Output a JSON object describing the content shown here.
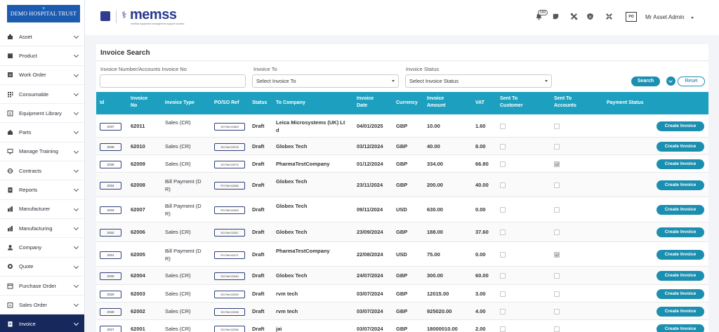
{
  "org": {
    "name": "DEMO HOSPITAL TRUST"
  },
  "brand": {
    "name": "memss",
    "tagline": "medical equipment management support solution"
  },
  "header": {
    "notification_count": "690",
    "user_name": "Mr Asset Admin",
    "avatar_text": "PO"
  },
  "sidebar": {
    "items": [
      {
        "label": "Asset",
        "icon": "asset-icon"
      },
      {
        "label": "Product",
        "icon": "product-icon"
      },
      {
        "label": "Work Order",
        "icon": "work-order-icon"
      },
      {
        "label": "Consumable",
        "icon": "consumable-icon"
      },
      {
        "label": "Equipment Library",
        "icon": "library-icon"
      },
      {
        "label": "Parts",
        "icon": "parts-icon"
      },
      {
        "label": "Manage Training",
        "icon": "training-icon"
      },
      {
        "label": "Contracts",
        "icon": "contracts-icon"
      },
      {
        "label": "Reports",
        "icon": "reports-icon"
      },
      {
        "label": "Manufacturer",
        "icon": "manufacturer-icon"
      },
      {
        "label": "Manufacturing",
        "icon": "manufacturing-icon"
      },
      {
        "label": "Company",
        "icon": "company-icon"
      },
      {
        "label": "Quote",
        "icon": "quote-icon"
      },
      {
        "label": "Purchase Order",
        "icon": "purchase-order-icon"
      },
      {
        "label": "Sales Order",
        "icon": "sales-order-icon"
      },
      {
        "label": "Invoice",
        "icon": "invoice-icon",
        "active": true
      }
    ]
  },
  "search": {
    "title": "Invoice Search",
    "invoice_number_label": "Invoice Number/Accounts Invoice No",
    "invoice_number_value": "",
    "invoice_to_label": "Invoice To",
    "invoice_to_value": "Select Invoice To",
    "invoice_status_label": "Invoice Status",
    "invoice_status_value": "Select Invoice Status",
    "search_label": "Search",
    "reset_label": "Reset"
  },
  "table": {
    "columns": {
      "id": "Id",
      "invoice_no_1": "Invoice",
      "invoice_no_2": "No",
      "type": "Invoice Type",
      "ref": "PO/SO Ref",
      "status": "Status",
      "to_company": "To Company",
      "date_1": "Invoice",
      "date_2": "Date",
      "currency": "Currency",
      "amount_1": "Invoice",
      "amount_2": "Amount",
      "vat": "VAT",
      "sent_customer_1": "Sent To",
      "sent_customer_2": "Customer",
      "sent_accounts_1": "Sent To",
      "sent_accounts_2": "Accounts",
      "payment_status": "Payment Status"
    },
    "create_label": "Create Invoice",
    "rows": [
      {
        "id": "2037",
        "no": "62011",
        "type1": "Sales (CR)",
        "type2": "",
        "ref": "SO Ref:21669",
        "status": "Draft",
        "company1": "Leica Microsystems (UK) Lt",
        "company2": "d",
        "date": "04/01/2025",
        "currency": "GBP",
        "amount": "10.00",
        "vat": "1.60",
        "sent_customer": false,
        "sent_accounts": false
      },
      {
        "id": "2035",
        "no": "62010",
        "type1": "Sales (CR)",
        "type2": "",
        "ref": "SO Ref:22378",
        "status": "Draft",
        "company1": "Globex Tech",
        "company2": "",
        "date": "03/12/2024",
        "currency": "GBP",
        "amount": "40.00",
        "vat": "8.00",
        "sent_customer": false,
        "sent_accounts": false
      },
      {
        "id": "2035",
        "no": "62009",
        "type1": "Sales (CR)",
        "type2": "",
        "ref": "SO Ref:22373",
        "status": "Draft",
        "company1": "PharmaTestCompany",
        "company2": "",
        "date": "01/12/2024",
        "currency": "GBP",
        "amount": "334.00",
        "vat": "66.80",
        "sent_customer": false,
        "sent_accounts": true
      },
      {
        "id": "2034",
        "no": "62008",
        "type1": "Bill Payment (D",
        "type2": "R)",
        "ref": "PO Ref:42466",
        "status": "Draft",
        "company1": "Globex Tech",
        "company2": "",
        "date": "23/11/2024",
        "currency": "GBP",
        "amount": "200.00",
        "vat": "40.00",
        "sent_customer": false,
        "sent_accounts": false
      },
      {
        "id": "2033",
        "no": "62007",
        "type1": "Bill Payment (D",
        "type2": "R)",
        "ref": "PO Ref:42463",
        "status": "Draft",
        "company1": "Globex Tech",
        "company2": "",
        "date": "09/11/2024",
        "currency": "USD",
        "amount": "630.00",
        "vat": "0.00",
        "sent_customer": false,
        "sent_accounts": false
      },
      {
        "id": "2032",
        "no": "62006",
        "type1": "Sales (CR)",
        "type2": "",
        "ref": "SO Ref:22357",
        "status": "Draft",
        "company1": "Globex Tech",
        "company2": "",
        "date": "23/09/2024",
        "currency": "GBP",
        "amount": "188.00",
        "vat": "37.60",
        "sent_customer": false,
        "sent_accounts": false
      },
      {
        "id": "2031",
        "no": "62005",
        "type1": "Bill Payment (D",
        "type2": "R)",
        "ref": "PO Ref:42471",
        "status": "Draft",
        "company1": "PharmaTestCompany",
        "company2": "",
        "date": "22/08/2024",
        "currency": "USD",
        "amount": "75.00",
        "vat": "0.00",
        "sent_customer": false,
        "sent_accounts": true
      },
      {
        "id": "2030",
        "no": "62004",
        "type1": "Sales (CR)",
        "type2": "",
        "ref": "SO Ref:22340",
        "status": "Draft",
        "company1": "Globex Tech",
        "company2": "",
        "date": "24/07/2024",
        "currency": "GBP",
        "amount": "300.00",
        "vat": "60.00",
        "sent_customer": false,
        "sent_accounts": false
      },
      {
        "id": "2029",
        "no": "62003",
        "type1": "Sales (CR)",
        "type2": "",
        "ref": "SO Ref:22339",
        "status": "Draft",
        "company1": "rvm tech",
        "company2": "",
        "date": "03/07/2024",
        "currency": "GBP",
        "amount": "12015.00",
        "vat": "3.00",
        "sent_customer": false,
        "sent_accounts": false
      },
      {
        "id": "2028",
        "no": "62002",
        "type1": "Sales (CR)",
        "type2": "",
        "ref": "SO Ref:22338",
        "status": "Draft",
        "company1": "rvm tech",
        "company2": "",
        "date": "03/07/2024",
        "currency": "GBP",
        "amount": "925020.00",
        "vat": "4.00",
        "sent_customer": false,
        "sent_accounts": false
      },
      {
        "id": "2027",
        "no": "62001",
        "type1": "Sales (CR)",
        "type2": "",
        "ref": "SO Ref:22336",
        "status": "Draft",
        "company1": "jai",
        "company2": "",
        "date": "03/07/2024",
        "currency": "GBP",
        "amount": "18000010.00",
        "vat": "2.00",
        "sent_customer": false,
        "sent_accounts": false
      }
    ]
  }
}
